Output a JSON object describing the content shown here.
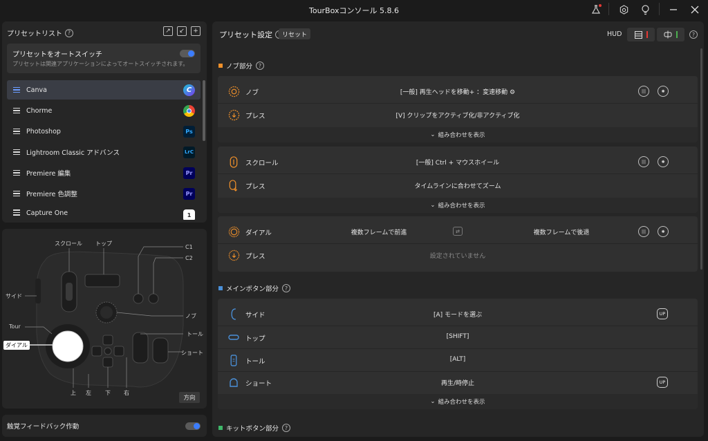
{
  "window": {
    "title": "TourBoxコンソール 5.8.6",
    "icons": [
      "flask-icon",
      "settings-icon",
      "lightbulb-icon",
      "minimize-icon",
      "close-icon"
    ]
  },
  "preset_list": {
    "title": "プリセットリスト",
    "help": "?",
    "tools": [
      "export-icon",
      "import-icon",
      "add-icon"
    ],
    "auto_switch": {
      "title": "プリセットをオートスイッチ",
      "desc": "プリセットは関連アプリケーションによってオートスイッチされます。",
      "enabled": true
    },
    "items": [
      {
        "label": "Canva",
        "icon": "canva-icon",
        "badge": "C",
        "selected": true
      },
      {
        "label": "Chorme",
        "icon": "chrome-icon",
        "badge": ""
      },
      {
        "label": "Photoshop",
        "icon": "photoshop-icon",
        "badge": "Ps"
      },
      {
        "label": "Lightroom Classic アドバンス",
        "icon": "lightroom-classic-icon",
        "badge": "LrC"
      },
      {
        "label": "Premiere 編集",
        "icon": "premiere-icon",
        "badge": "Pr"
      },
      {
        "label": "Premiere 色調整",
        "icon": "premiere-icon",
        "badge": "Pr"
      },
      {
        "label": "Capture One",
        "icon": "capture-one-icon",
        "badge": "1"
      }
    ]
  },
  "device": {
    "labels": {
      "scroll": "スクロール",
      "top": "トップ",
      "c1": "C1",
      "c2": "C2",
      "side": "サイド",
      "knob": "ノブ",
      "tour": "Tour",
      "tall": "トール",
      "dial": "ダイアル",
      "short": "ショート",
      "up": "上",
      "left": "左",
      "down": "下",
      "right": "右"
    },
    "direction_button": "方向"
  },
  "haptic": {
    "label": "触覚フィードバック作動",
    "enabled": true
  },
  "settings": {
    "title": "プリセット設定",
    "help": "?",
    "reset": "リセット",
    "hud": "HUD"
  },
  "sections": {
    "knob": {
      "title": "ノブ部分",
      "color": "#f0902a",
      "groups": [
        {
          "rows": [
            {
              "name": "ノブ",
              "value": "[一般] 再生ヘッドを移動+ ：変速移動",
              "icon": "knob-icon"
            },
            {
              "name": "プレス",
              "value": "[V] クリップをアクティブ化/非アクティブ化",
              "icon": "knob-press-icon"
            }
          ],
          "combo": "組み合わせを表示"
        },
        {
          "rows": [
            {
              "name": "スクロール",
              "value": "[一般] Ctrl + マウスホイール",
              "icon": "scroll-icon"
            },
            {
              "name": "プレス",
              "value": "タイムラインに合わせてズーム",
              "icon": "scroll-press-icon"
            }
          ],
          "combo": "組み合わせを表示"
        },
        {
          "rows": [
            {
              "name": "ダイアル",
              "value_left": "複数フレームで前進",
              "value_right": "複数フレームで後退",
              "icon": "dial-icon"
            },
            {
              "name": "プレス",
              "value": "設定されていません",
              "icon": "dial-press-icon"
            }
          ]
        }
      ]
    },
    "main": {
      "title": "メインボタン部分",
      "color": "#4a90d9",
      "rows": [
        {
          "name": "サイド",
          "value": "[A] モードを選ぶ",
          "icon": "side-button-icon",
          "up": "UP"
        },
        {
          "name": "トップ",
          "value": "[SHIFT]",
          "icon": "top-button-icon"
        },
        {
          "name": "トール",
          "value": "[ALT]",
          "icon": "tall-button-icon"
        },
        {
          "name": "ショート",
          "value": "再生/時停止",
          "icon": "short-button-icon",
          "up": "UP"
        }
      ],
      "combo": "組み合わせを表示"
    },
    "kit": {
      "title": "キットボタン部分",
      "color": "#3fb86a"
    }
  }
}
